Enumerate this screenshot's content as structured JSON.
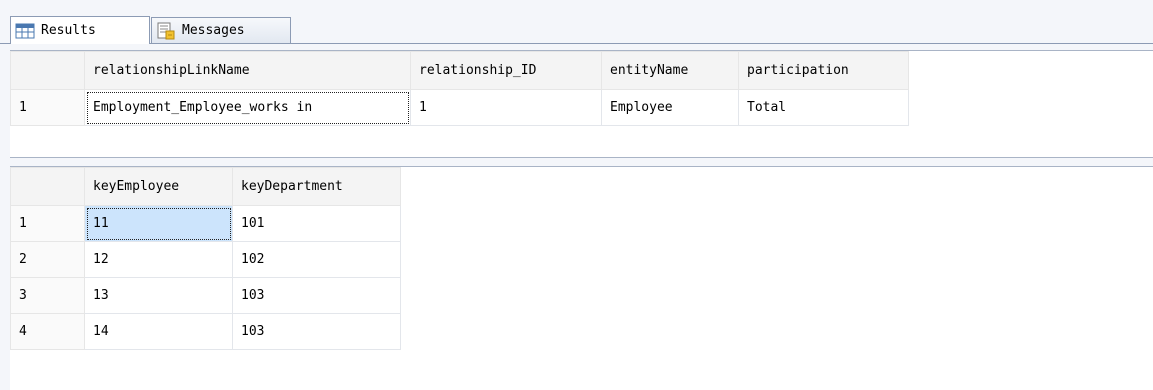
{
  "tabs": {
    "results_label": "Results",
    "messages_label": "Messages"
  },
  "grid1": {
    "columns": [
      "relationshipLinkName",
      "relationship_ID",
      "entityName",
      "participation"
    ],
    "rows": [
      {
        "num": "1",
        "cells": [
          "Employment_Employee_works in",
          "1",
          "Employee",
          "Total"
        ]
      }
    ]
  },
  "grid2": {
    "columns": [
      "keyEmployee",
      "keyDepartment"
    ],
    "rows": [
      {
        "num": "1",
        "cells": [
          "11",
          "101"
        ]
      },
      {
        "num": "2",
        "cells": [
          "12",
          "102"
        ]
      },
      {
        "num": "3",
        "cells": [
          "13",
          "103"
        ]
      },
      {
        "num": "4",
        "cells": [
          "14",
          "103"
        ]
      }
    ]
  },
  "colors": {
    "selection": "#cce4fc",
    "tab_border": "#8c9bb4",
    "header_bg": "#f4f4f4"
  },
  "icons": {
    "results": "grid-icon",
    "messages": "messages-icon"
  }
}
